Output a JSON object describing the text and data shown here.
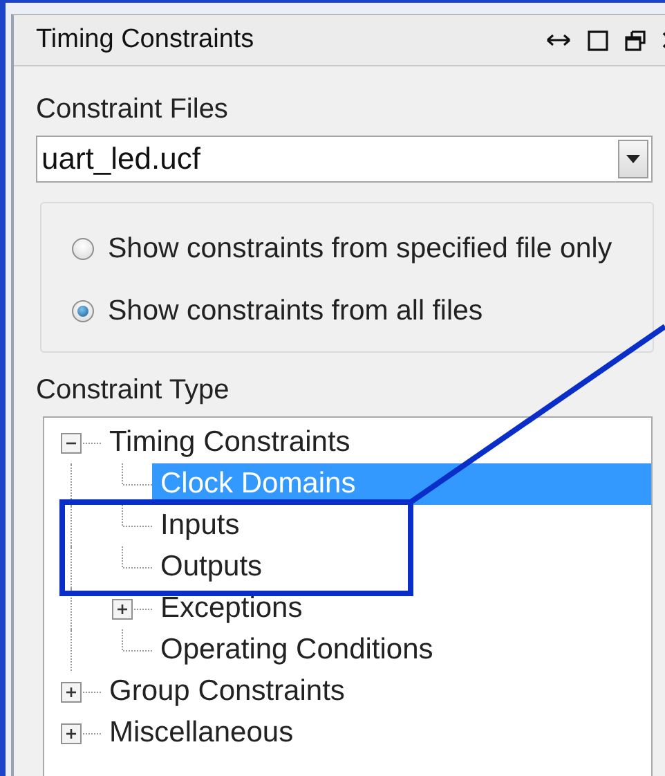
{
  "panel": {
    "title": "Timing Constraints"
  },
  "constraint_files": {
    "label": "Constraint Files",
    "value": "uart_led.ucf"
  },
  "scope_options": [
    {
      "label": "Show constraints from specified file only",
      "selected": false
    },
    {
      "label": "Show constraints from all files",
      "selected": true
    }
  ],
  "constraint_type": {
    "label": "Constraint Type",
    "tree": [
      {
        "label": "Timing Constraints",
        "expanded": true,
        "selected": false,
        "children": [
          {
            "label": "Clock Domains",
            "selected": true
          },
          {
            "label": "Inputs",
            "selected": false
          },
          {
            "label": "Outputs",
            "selected": false
          },
          {
            "label": "Exceptions",
            "expanded": false,
            "selected": false
          },
          {
            "label": "Operating Conditions",
            "selected": false
          }
        ]
      },
      {
        "label": "Group Constraints",
        "expanded": false,
        "selected": false
      },
      {
        "label": "Miscellaneous",
        "expanded": false,
        "selected": false
      }
    ]
  }
}
